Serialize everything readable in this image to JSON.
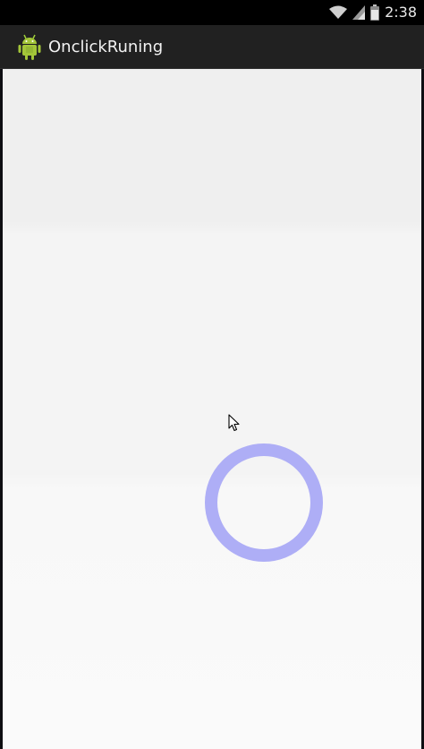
{
  "status_bar": {
    "time": "2:38",
    "icons": [
      "wifi-icon",
      "cell-signal-icon",
      "battery-icon"
    ]
  },
  "action_bar": {
    "title": "OnclickRuning",
    "icon": "android-robot-icon"
  },
  "canvas": {
    "ring_color": "#aeaef6",
    "cursor": "mouse-pointer-icon"
  }
}
